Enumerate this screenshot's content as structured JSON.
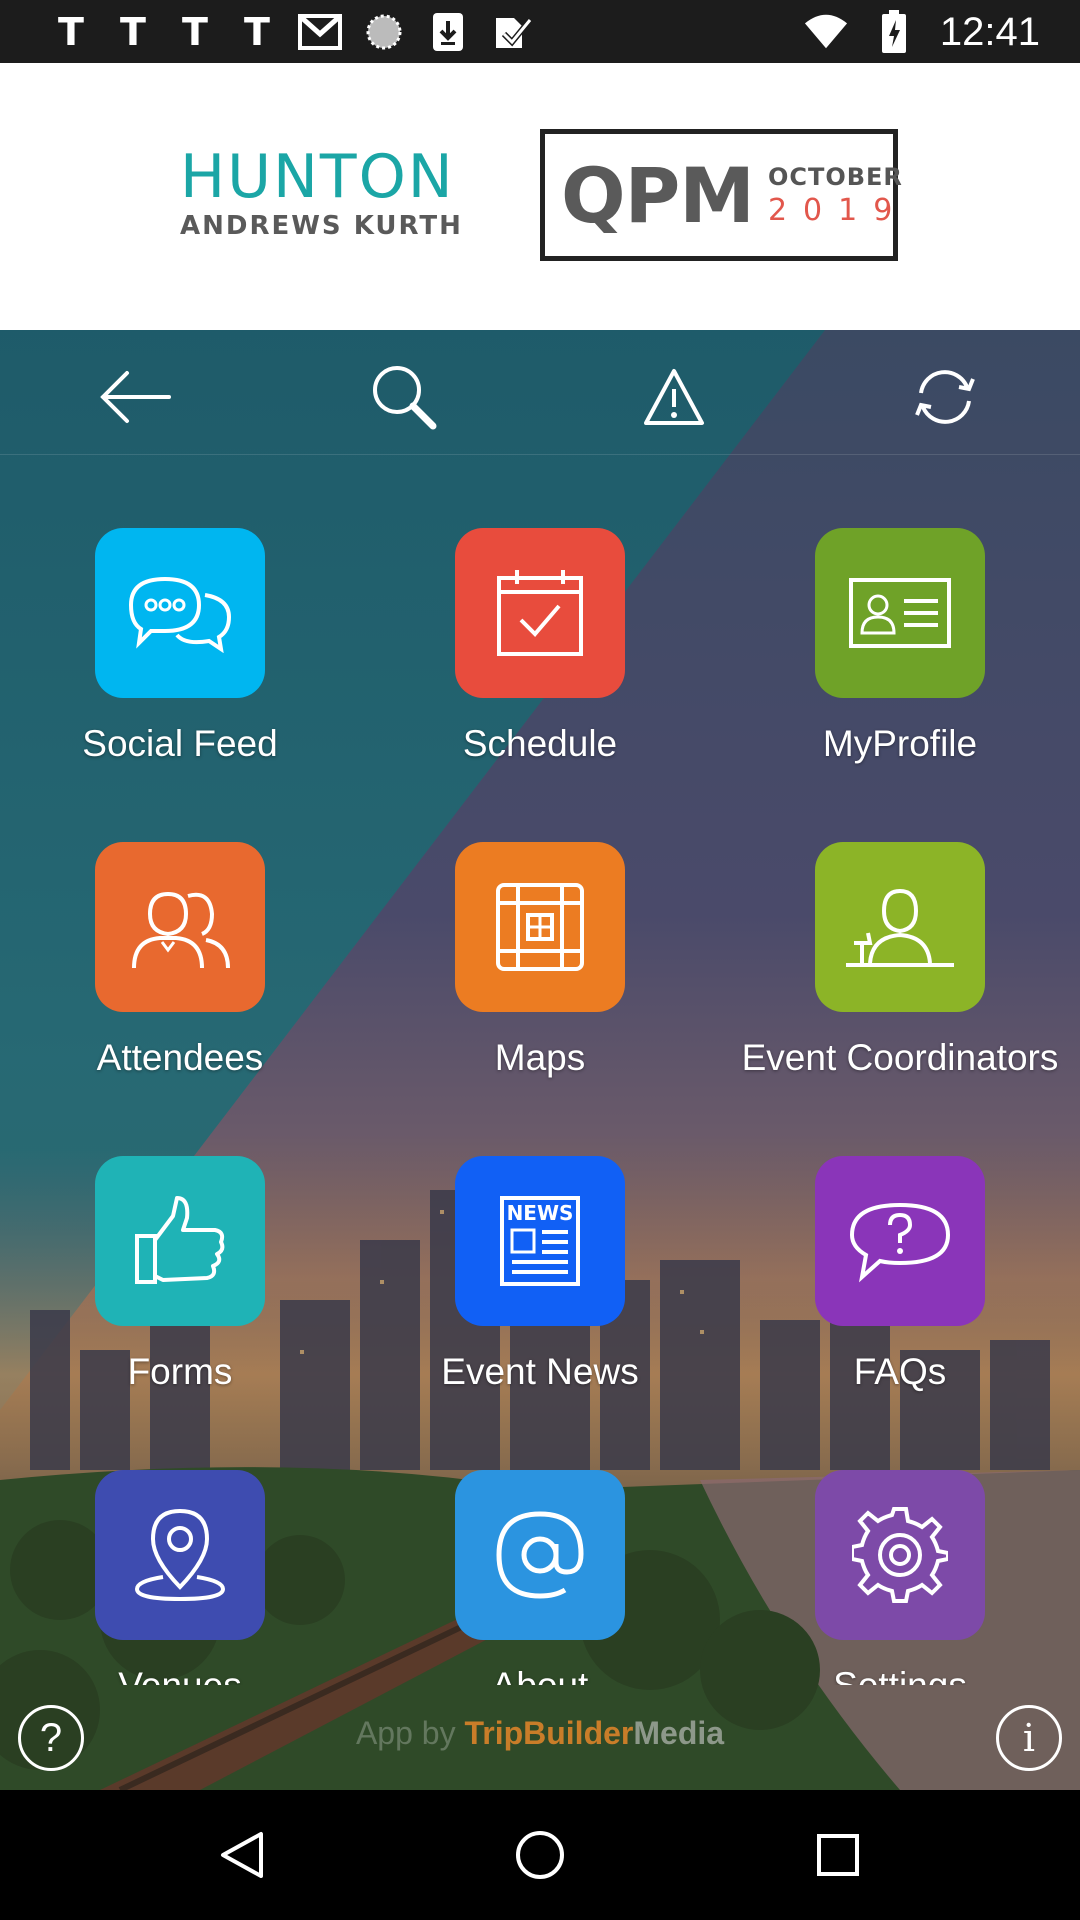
{
  "status_bar": {
    "time": "12:41",
    "notif_letters": [
      "T",
      "T",
      "T",
      "T"
    ],
    "icons": [
      "gmail-icon",
      "loading-icon",
      "download-icon",
      "check-icon",
      "wifi-icon",
      "battery-icon"
    ]
  },
  "header": {
    "brand_line1": "HUNTON",
    "brand_line2": "ANDREWS KURTH",
    "event_name": "QPM",
    "event_month": "OCTOBER",
    "event_year": "2019"
  },
  "toolbar": {
    "icons": [
      "back-arrow-icon",
      "search-icon",
      "alert-icon",
      "refresh-icon"
    ]
  },
  "tiles": [
    {
      "label": "Social Feed",
      "icon": "chat-bubbles-icon",
      "color": "#00b6f0"
    },
    {
      "label": "Schedule",
      "icon": "calendar-check-icon",
      "color": "#e84c3d"
    },
    {
      "label": "MyProfile",
      "icon": "id-card-icon",
      "color": "#6fa228"
    },
    {
      "label": "Attendees",
      "icon": "people-icon",
      "color": "#e8692f"
    },
    {
      "label": "Maps",
      "icon": "floor-map-icon",
      "color": "#ec7c22"
    },
    {
      "label": "Event Coordinators",
      "icon": "speaker-icon",
      "color": "#8cb427"
    },
    {
      "label": "Forms",
      "icon": "thumbs-up-icon",
      "color": "#1fb3b6"
    },
    {
      "label": "Event News",
      "icon": "newspaper-icon",
      "color": "#1160f5"
    },
    {
      "label": "FAQs",
      "icon": "question-bubble-icon",
      "color": "#8a35b9"
    },
    {
      "label": "Venues",
      "icon": "map-pin-icon",
      "color": "#3e4cb0"
    },
    {
      "label": "About",
      "icon": "at-sign-icon",
      "color": "#2b94e0"
    },
    {
      "label": "Settings",
      "icon": "gear-icon",
      "color": "#7d4aa8"
    }
  ],
  "footer": {
    "powered_prefix": "App by",
    "powered_brand": "TripBuilder",
    "powered_suffix": "Media",
    "help_symbol": "?",
    "info_symbol": "i"
  },
  "navbar": {
    "icons": [
      "nav-back-icon",
      "nav-home-icon",
      "nav-recents-icon"
    ]
  }
}
